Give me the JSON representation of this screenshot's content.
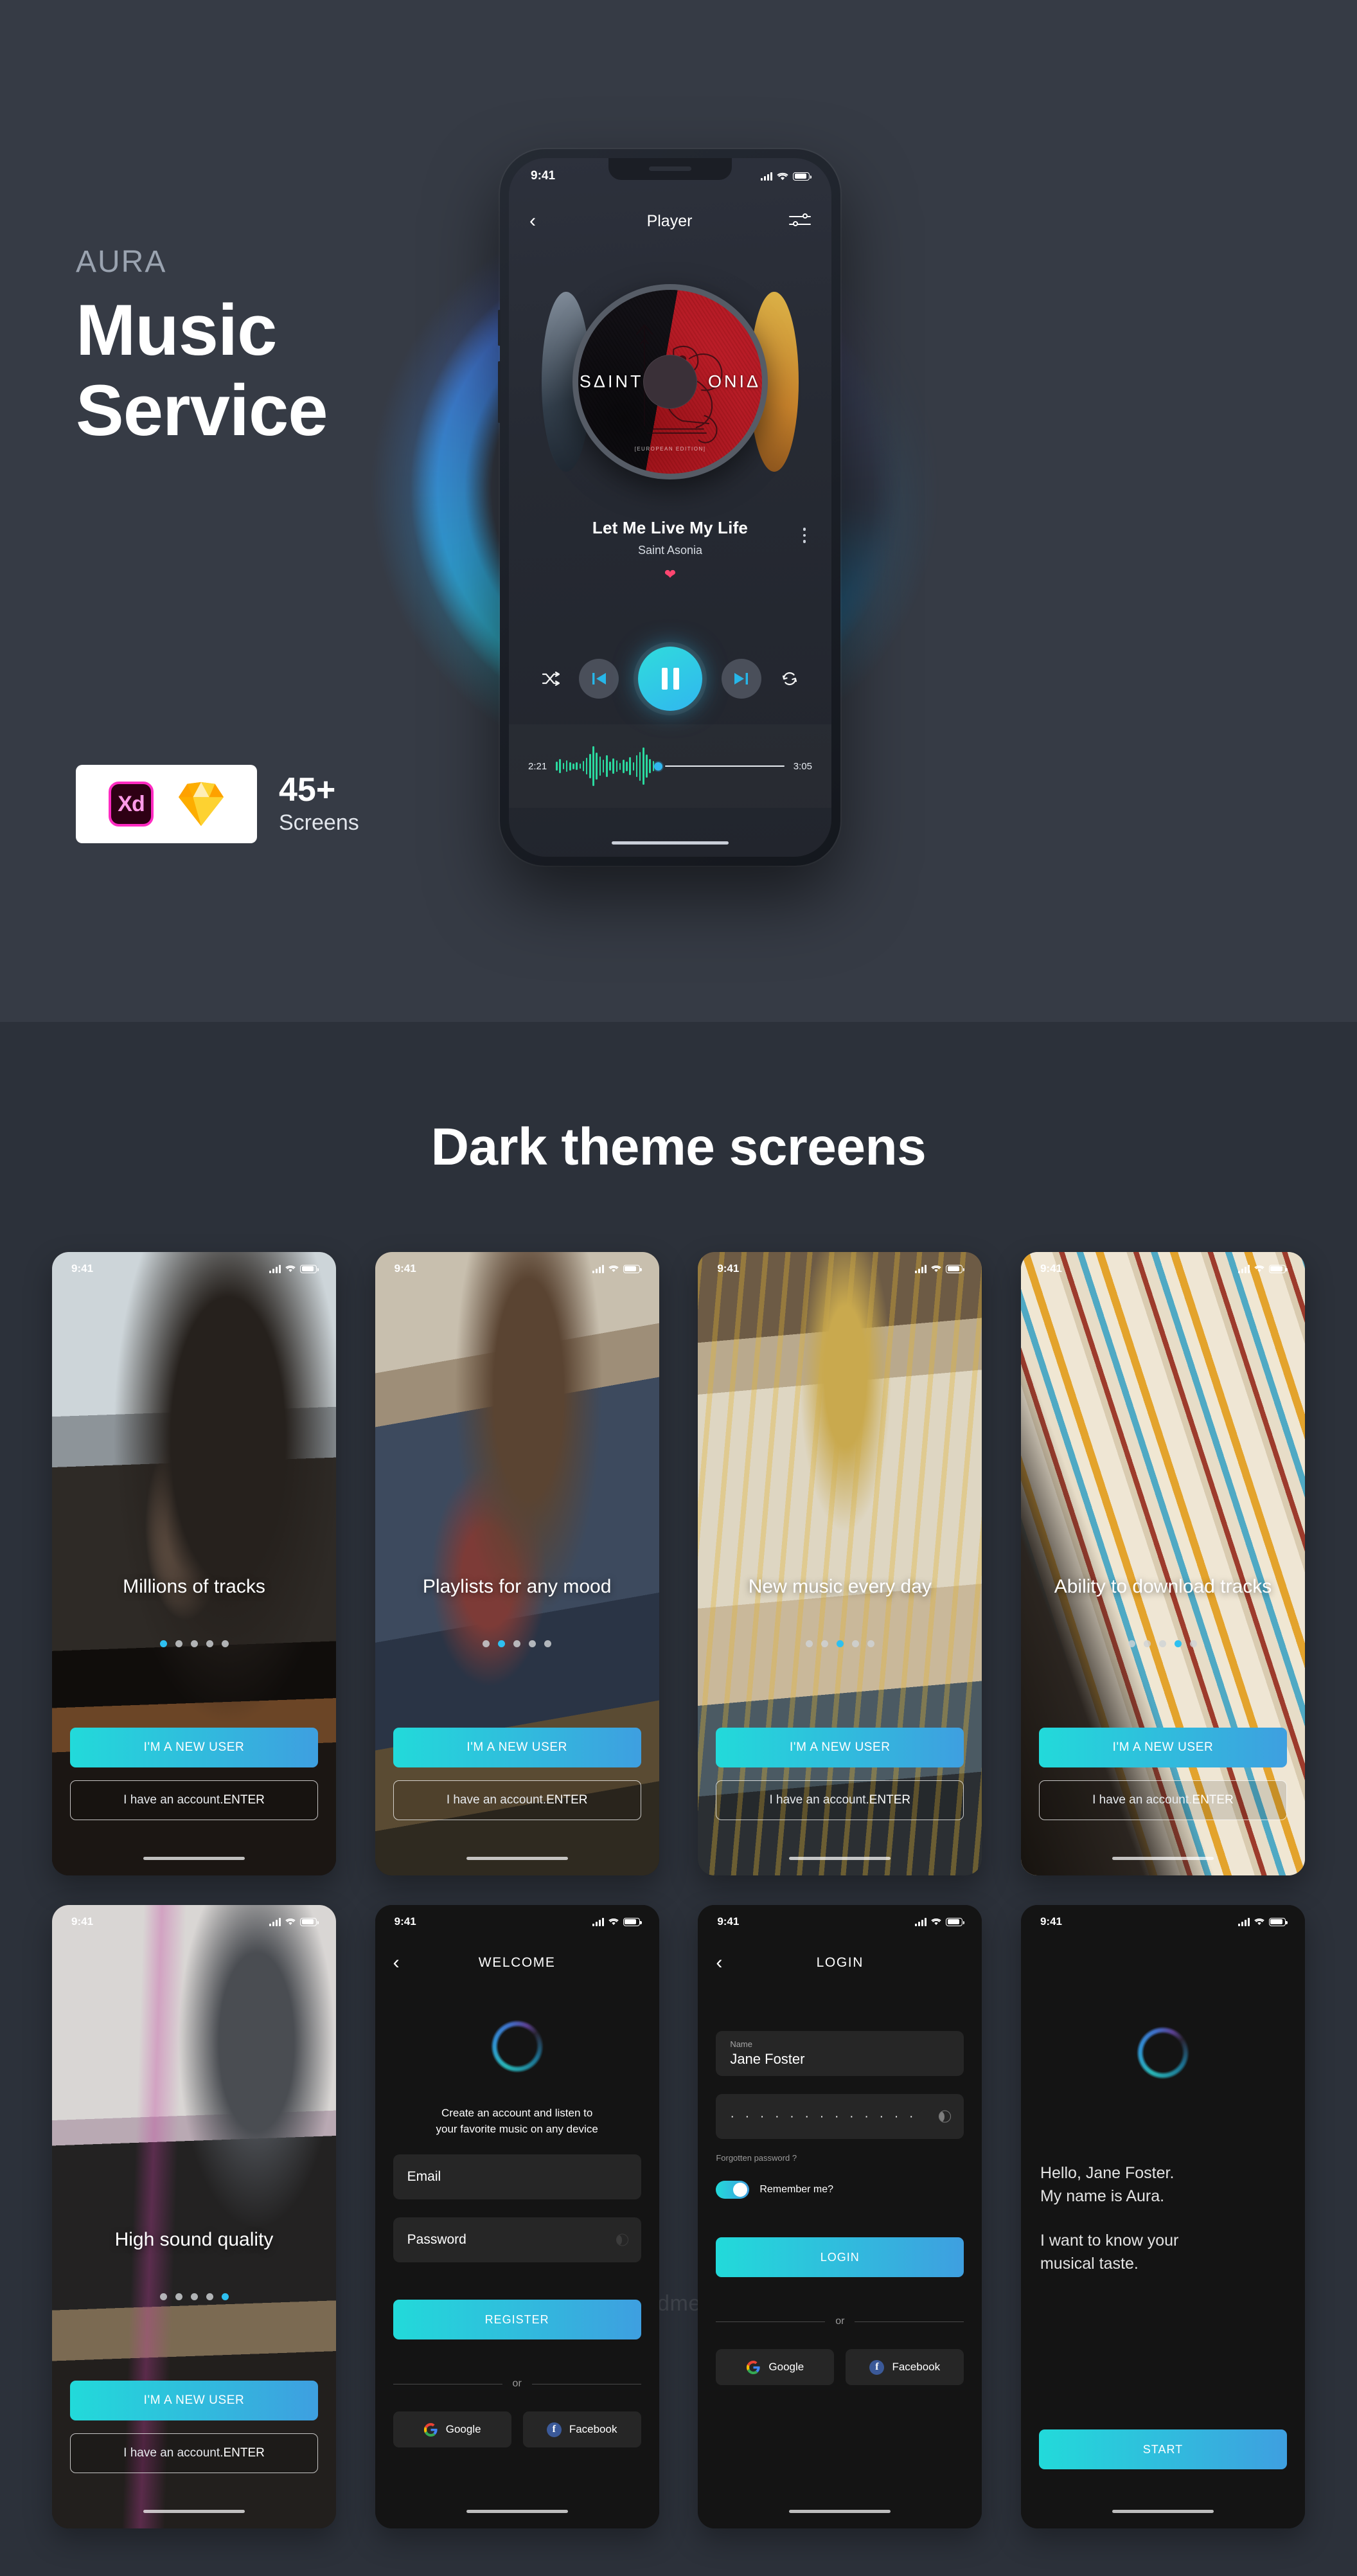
{
  "hero": {
    "brand": "AURA",
    "title_line1": "Music",
    "title_line2": "Service",
    "tools": {
      "xd_label": "Xd",
      "xd_icon": "adobe-xd-icon",
      "sketch_icon": "sketch-diamond-icon"
    },
    "screens_count": "45+",
    "screens_label": "Screens"
  },
  "hero_phone": {
    "status": {
      "time": "9:41",
      "signal_icon": "signal-bars-icon",
      "wifi_icon": "wifi-icon",
      "battery_icon": "battery-icon"
    },
    "nav": {
      "back_icon": "chevron-left-icon",
      "title": "Player",
      "equalizer_icon": "equalizer-sliders-icon"
    },
    "album": {
      "disc_label": "SAΔINT ASONIΔ",
      "disc_label_left": "SΔINT",
      "disc_label_right": "ONIΔ",
      "edition": "[EUROPEAN EDITION]"
    },
    "track": {
      "title": "Let Me Live My Life",
      "artist": "Saint Asonia",
      "favorite_icon": "heart-filled-icon",
      "more_icon": "kebab-menu-icon"
    },
    "controls": {
      "shuffle_icon": "shuffle-icon",
      "previous_icon": "skip-previous-icon",
      "play_pause_icon": "pause-icon",
      "next_icon": "skip-next-icon",
      "repeat_icon": "repeat-icon"
    },
    "progress": {
      "elapsed": "2:21",
      "duration": "3:05",
      "waveform_icon": "audio-waveform-icon"
    }
  },
  "section2": {
    "title": "Dark theme screens",
    "watermark": "gooodme.com"
  },
  "onboarding": {
    "status_time": "9:41",
    "primary_button": "I'M A NEW USER",
    "secondary_prefix": "I have an account. ",
    "secondary_action": "ENTER",
    "dots_total": 5,
    "cards": [
      {
        "title": "Millions of tracks",
        "active_dot": 0,
        "photo": "ph1"
      },
      {
        "title": "Playlists for any mood",
        "active_dot": 1,
        "photo": "ph2"
      },
      {
        "title": "New music every day",
        "active_dot": 2,
        "photo": "ph3"
      },
      {
        "title": "Ability to download tracks",
        "active_dot": 3,
        "photo": "ph4"
      },
      {
        "title": "High sound quality",
        "active_dot": 4,
        "photo": "ph5"
      }
    ]
  },
  "welcome_screen": {
    "status_time": "9:41",
    "back_icon": "chevron-left-icon",
    "title": "WELCOME",
    "logo_icon": "aura-ring-logo-icon",
    "blurb_line1": "Create an account and listen to",
    "blurb_line2": "your favorite music on any device",
    "email_placeholder": "Email",
    "password_placeholder": "Password",
    "register_button": "REGISTER",
    "or_label": "or",
    "google_button": "Google",
    "google_icon": "google-g-icon",
    "facebook_button": "Facebook",
    "facebook_icon": "facebook-f-icon"
  },
  "login_screen": {
    "status_time": "9:41",
    "back_icon": "chevron-left-icon",
    "title": "LOGIN",
    "name_label": "Name",
    "name_value": "Jane Foster",
    "password_masked": "· · · · · · · · · · · · ·",
    "password_toggle_icon": "show-password-eye-icon",
    "forgotten_label": "Forgotten password ?",
    "remember_label": "Remember me?",
    "remember_on": true,
    "login_button": "LOGIN",
    "or_label": "or",
    "google_button": "Google",
    "google_icon": "google-g-icon",
    "facebook_button": "Facebook",
    "facebook_icon": "facebook-f-icon"
  },
  "aura_screen": {
    "status_time": "9:41",
    "logo_icon": "aura-ring-logo-icon",
    "greeting_line1": "Hello, Jane Foster.",
    "greeting_line2": "My name is Aura.",
    "greeting_line3": "I want to know your",
    "greeting_line4": "musical taste.",
    "start_button": "START"
  },
  "colors": {
    "accent_cyan": "#2ec0f0",
    "accent_teal": "#22dada",
    "accent_blue": "#3e9fe0",
    "heart_pink": "#ff4670",
    "wave_green": "#2bd99f",
    "hero_bg": "#363b45",
    "section_bg": "#2c313a",
    "card_bg": "#141414"
  }
}
